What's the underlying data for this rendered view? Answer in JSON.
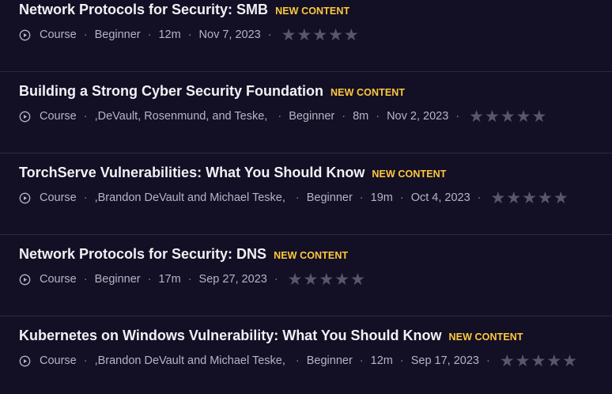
{
  "courses": [
    {
      "title": "Network Protocols for Security: SMB",
      "badge": "NEW CONTENT",
      "type": "Course",
      "authors": "",
      "level": "Beginner",
      "duration": "12m",
      "date": "Nov 7, 2023",
      "rating": 0
    },
    {
      "title": "Building a Strong Cyber Security Foundation",
      "badge": "NEW CONTENT",
      "type": "Course",
      "authors": ",DeVault, Rosenmund, and Teske,",
      "level": "Beginner",
      "duration": "8m",
      "date": "Nov 2, 2023",
      "rating": 0
    },
    {
      "title": "TorchServe Vulnerabilities: What You Should Know",
      "badge": "NEW CONTENT",
      "type": "Course",
      "authors": ",Brandon DeVault and Michael Teske,",
      "level": "Beginner",
      "duration": "19m",
      "date": "Oct 4, 2023",
      "rating": 0
    },
    {
      "title": "Network Protocols for Security: DNS",
      "badge": "NEW CONTENT",
      "type": "Course",
      "authors": "",
      "level": "Beginner",
      "duration": "17m",
      "date": "Sep 27, 2023",
      "rating": 0
    },
    {
      "title": "Kubernetes on Windows Vulnerability: What You Should Know",
      "badge": "NEW CONTENT",
      "type": "Course",
      "authors": ",Brandon DeVault and Michael Teske,",
      "level": "Beginner",
      "duration": "12m",
      "date": "Sep 17, 2023",
      "rating": 0
    }
  ],
  "separator": "·",
  "star_glyph": "★",
  "colors": {
    "background": "#130f25",
    "title": "#f1f1f4",
    "badge": "#ffc93c",
    "meta": "#b6b4c3",
    "star_empty": "#59566b",
    "divider": "#2d2947"
  },
  "icons": {
    "type_icon": "play-circle-icon",
    "rating_icon": "star-icon"
  }
}
